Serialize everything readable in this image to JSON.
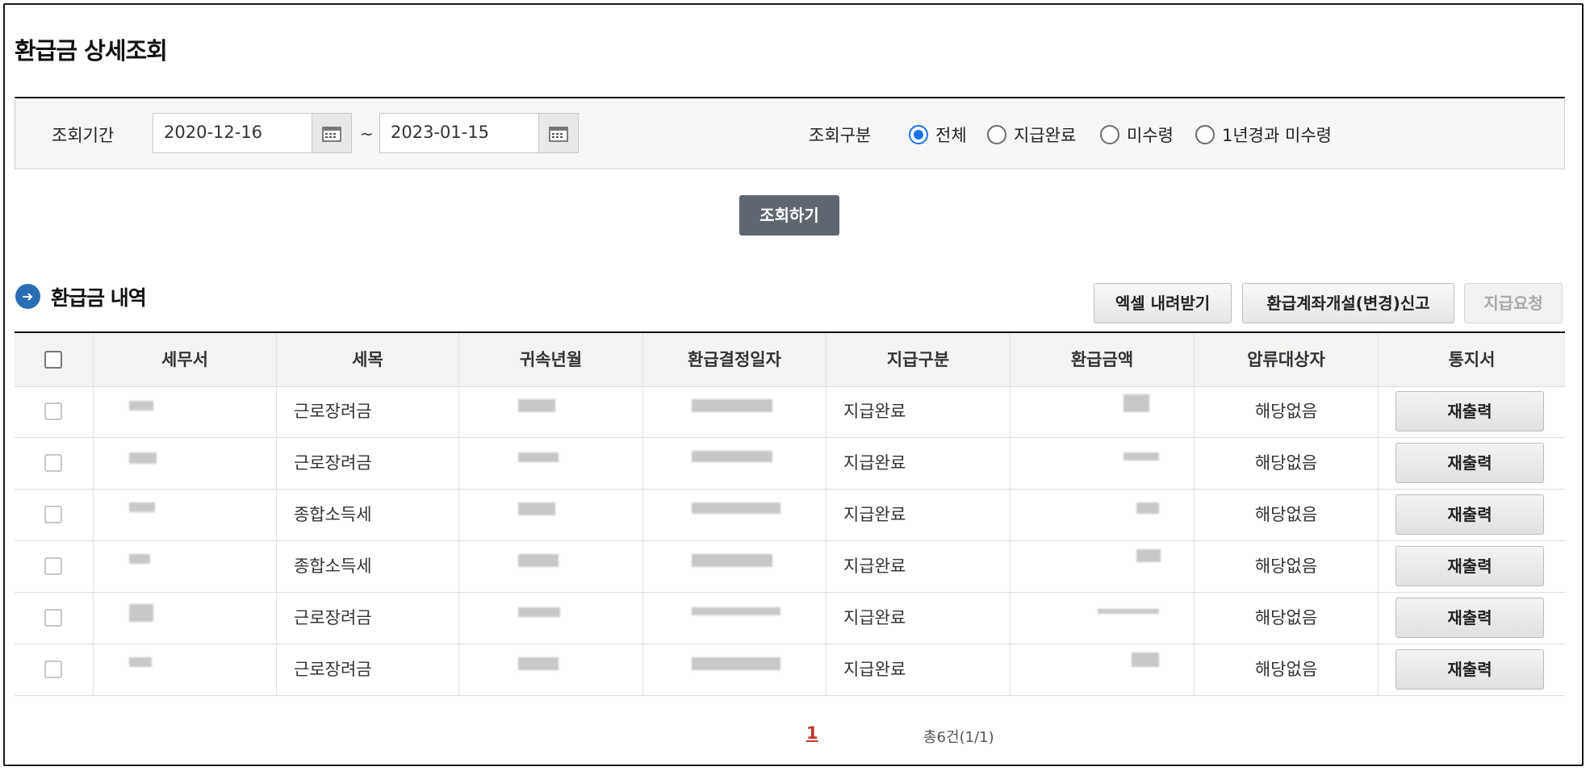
{
  "page": {
    "title": "환급금 상세조회"
  },
  "search": {
    "period_label": "조회기간",
    "start_date": "2020-12-16",
    "end_date": "2023-01-15",
    "tilde": "~",
    "kind_label": "조회구분",
    "options": [
      {
        "label": "전체",
        "selected": true
      },
      {
        "label": "지급완료",
        "selected": false
      },
      {
        "label": "미수령",
        "selected": false
      },
      {
        "label": "1년경과 미수령",
        "selected": false
      }
    ],
    "submit_label": "조회하기"
  },
  "section": {
    "title": "환급금 내역",
    "excel_button": "엑셀 내려받기",
    "account_button": "환급계좌개설(변경)신고",
    "request_button": "지급요청"
  },
  "table": {
    "headers": [
      "세무서",
      "세목",
      "귀속년월",
      "환급결정일자",
      "지급구분",
      "환급금액",
      "압류대상자",
      "통지서"
    ],
    "rows": [
      {
        "tax_item": "근로장려금",
        "pay_type": "지급완료",
        "seizure": "해당없음",
        "action": "재출력"
      },
      {
        "tax_item": "근로장려금",
        "pay_type": "지급완료",
        "seizure": "해당없음",
        "action": "재출력"
      },
      {
        "tax_item": "종합소득세",
        "pay_type": "지급완료",
        "seizure": "해당없음",
        "action": "재출력"
      },
      {
        "tax_item": "종합소득세",
        "pay_type": "지급완료",
        "seizure": "해당없음",
        "action": "재출력"
      },
      {
        "tax_item": "근로장려금",
        "pay_type": "지급완료",
        "seizure": "해당없음",
        "action": "재출력"
      },
      {
        "tax_item": "근로장려금",
        "pay_type": "지급완료",
        "seizure": "해당없음",
        "action": "재출력"
      }
    ]
  },
  "pager": {
    "current": "1",
    "total": "총6건(1/1)"
  },
  "colors": {
    "accent": "#1a73e8",
    "search_button": "#5e6670",
    "section_icon": "#2a6fb3",
    "pager_current": "#c0392b"
  }
}
